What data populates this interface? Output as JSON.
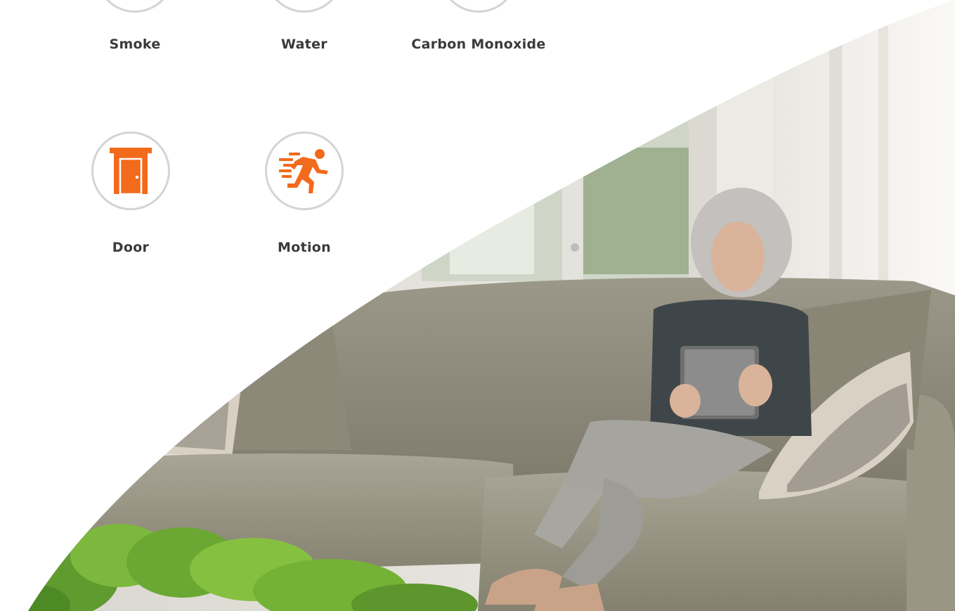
{
  "sensors": [
    {
      "label": "Smoke",
      "icon": "smoke-icon"
    },
    {
      "label": "Water",
      "icon": "water-icon"
    },
    {
      "label": "Carbon Monoxide",
      "icon": "carbon-monoxide-icon"
    },
    {
      "label": "Door",
      "icon": "door-icon"
    },
    {
      "label": "Motion",
      "icon": "motion-icon"
    }
  ],
  "colors": {
    "accent": "#f26a1b",
    "ring": "#d4d4d4",
    "label": "#3a3a3a"
  },
  "hero": {
    "image": "woman-on-sofa-with-tablet-photo"
  }
}
